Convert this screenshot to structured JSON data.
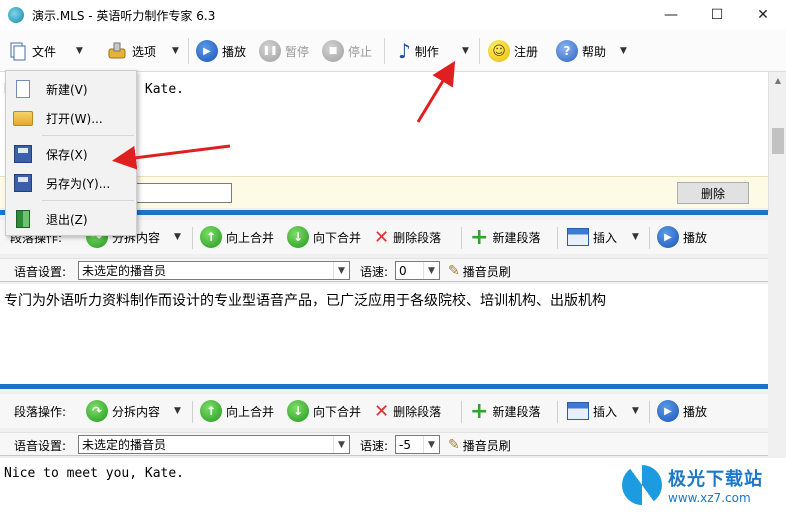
{
  "window": {
    "title": "演示.MLS - 英语听力制作专家 6.3",
    "minimize": "—",
    "maximize": "☐",
    "close": "✕"
  },
  "toolbar": {
    "file": "文件",
    "options": "选项",
    "play": "播放",
    "pause": "暂停",
    "stop": "停止",
    "produce": "制作",
    "register": "注册",
    "help": "帮助"
  },
  "file_menu": {
    "new": "新建(V)",
    "open": "打开(W)...",
    "save": "保存(X)",
    "save_as": "另存为(Y)...",
    "exit": "退出(Z)"
  },
  "pane1": {
    "text": "Nice to meet you, Kate.",
    "delete_button": "删除"
  },
  "para_bar": {
    "label": "段落操作:",
    "split": "分拆内容",
    "merge_up": "向上合并",
    "merge_down": "向下合并",
    "delete_para": "删除段落",
    "new_para": "新建段落",
    "insert": "插入",
    "play": "播放"
  },
  "voice_bar1": {
    "label": "语音设置:",
    "speaker": "未选定的播音员",
    "speed_label": "语速:",
    "speed": "0",
    "brush": "播音员刷"
  },
  "pane2": {
    "text": "专门为外语听力资料制作而设计的专业型语音产品，已广泛应用于各级院校、培训机构、出版机构"
  },
  "voice_bar2": {
    "label": "语音设置:",
    "speaker": "未选定的播音员",
    "speed_label": "语速:",
    "speed": "-5",
    "brush": "播音员刷"
  },
  "pane3": {
    "text": "Nice to meet you, Kate."
  },
  "watermark": {
    "name": "极光下载站",
    "url": "www.xz7.com"
  },
  "colors": {
    "accent_blue": "#1c73c8",
    "annotation_red": "#e02020",
    "yellow_bar": "#fdfbe5"
  }
}
